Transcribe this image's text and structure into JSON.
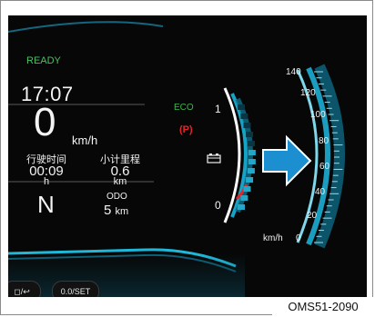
{
  "status": {
    "ready": "READY"
  },
  "clock": "17:07",
  "speed": {
    "value": "0",
    "unit": "km/h"
  },
  "trip": {
    "time_label": "行驶时间",
    "time_value": "00:09",
    "time_unit": "h",
    "distance_label": "小计里程",
    "distance_value": "0.6",
    "distance_unit": "km"
  },
  "gear": "N",
  "odo": {
    "label": "ODO",
    "value": "5",
    "unit": "km"
  },
  "indicators": {
    "eco": "ECO",
    "parking_brake": "(P)",
    "battery_icon": "battery-icon"
  },
  "power_gauge": {
    "top_label": "1",
    "bottom_label": "0",
    "level": 0.55
  },
  "speedometer": {
    "ticks": [
      "140",
      "120",
      "100",
      "80",
      "60",
      "40",
      "20",
      "0"
    ],
    "unit": "km/h"
  },
  "buttons": {
    "back": "◻/↩",
    "set": "0.0/SET"
  },
  "caption": "OMS51-2090",
  "colors": {
    "accent": "#22a7c8",
    "eco": "#3bb54a",
    "warning": "#e0262b",
    "arrow": "#1c8fd1"
  }
}
